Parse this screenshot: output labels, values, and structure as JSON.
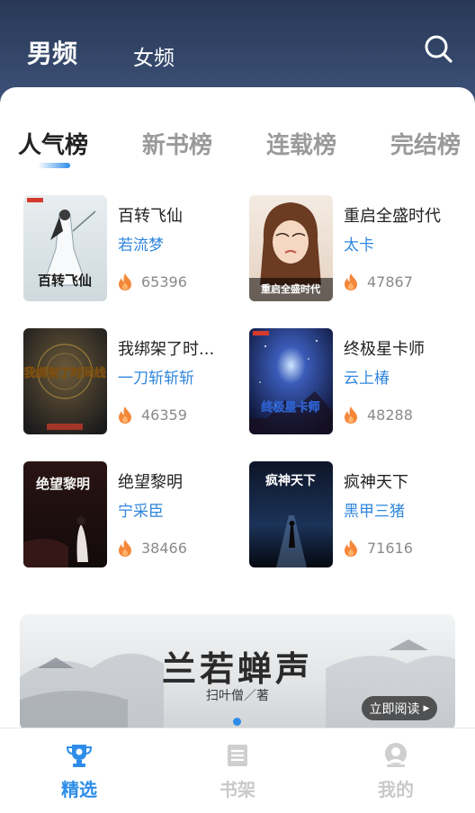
{
  "header": {
    "tabs": [
      {
        "label": "男频",
        "active": true
      },
      {
        "label": "女频",
        "active": false
      }
    ],
    "search_icon": "search-icon"
  },
  "rank_tabs": [
    {
      "label": "人气榜",
      "active": true
    },
    {
      "label": "新书榜",
      "active": false
    },
    {
      "label": "连载榜",
      "active": false
    },
    {
      "label": "完结榜",
      "active": false
    }
  ],
  "books": [
    {
      "title": "百转飞仙",
      "author": "若流梦",
      "heat": "65396",
      "cover_text": "百转飞仙"
    },
    {
      "title": "重启全盛时代",
      "author": "太卡",
      "heat": "47867",
      "cover_text": "重启全盛时代"
    },
    {
      "title": "我绑架了时...",
      "author": "一刀斩斩斩",
      "heat": "46359",
      "cover_text": "我绑架了时间线"
    },
    {
      "title": "终极星卡师",
      "author": "云上椿",
      "heat": "48288",
      "cover_text": "终极星卡师"
    },
    {
      "title": "绝望黎明",
      "author": "宁采臣",
      "heat": "38466",
      "cover_text": "绝望黎明"
    },
    {
      "title": "疯神天下",
      "author": "黑甲三猪",
      "heat": "71616",
      "cover_text": "疯神天下"
    }
  ],
  "banner": {
    "title": "兰若蝉声",
    "subtitle": "扫叶僧／著",
    "button_label": "立即阅读"
  },
  "bottom_nav": [
    {
      "label": "精选",
      "icon": "trophy-icon",
      "active": true
    },
    {
      "label": "书架",
      "icon": "bookshelf-icon",
      "active": false
    },
    {
      "label": "我的",
      "icon": "profile-icon",
      "active": false
    }
  ],
  "colors": {
    "accent": "#2e8de8",
    "author": "#2f86dc",
    "header_bg": "#2b3a55",
    "fire": "#f5873a"
  }
}
